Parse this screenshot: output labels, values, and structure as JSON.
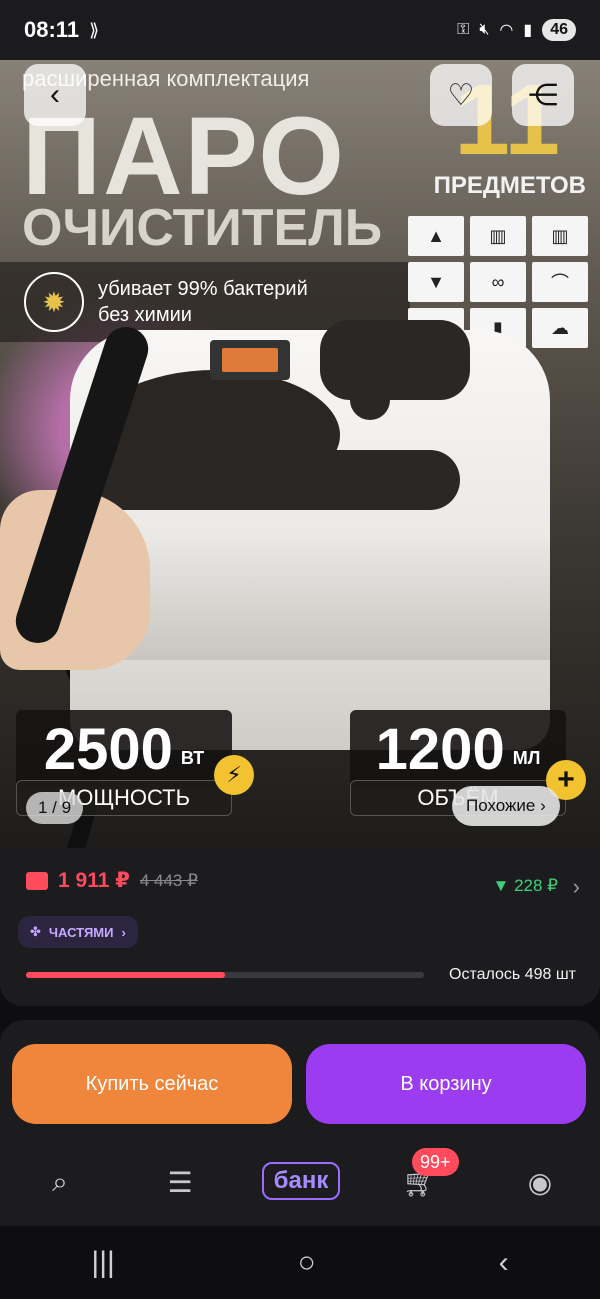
{
  "status_bar": {
    "time": "08:11",
    "battery": "46"
  },
  "product_image": {
    "top_text": "расширенная комплектация",
    "title_line1": "ПАРО",
    "title_line2": "ОЧИСТИТЕЛЬ",
    "items_count": "11",
    "items_label": "ПРЕДМЕТОВ",
    "badge_text_line1": "убивает 99% бактерий",
    "badge_text_line2": "без химии",
    "power_value": "2500",
    "power_unit": "ВТ",
    "power_label": "МОЩНОСТЬ",
    "volume_value": "1200",
    "volume_unit": "МЛ",
    "volume_label": "ОБЪЁМ",
    "pager": "1 / 9",
    "similar_label": "Похожие ›",
    "icons": {
      "back": "chevron-left-icon",
      "favorite": "heart-icon",
      "share": "share-icon"
    }
  },
  "price": {
    "current": "1 911 ₽",
    "old": "4 443 ₽",
    "cashback": "▼ 228 ₽",
    "installments_label": "ЧАСТЯМИ",
    "stock_label": "Осталось 498 шт",
    "stock_progress": 0.5
  },
  "actions": {
    "buy_now": "Купить сейчас",
    "add_to_cart": "В корзину"
  },
  "tabbar": {
    "bank_label": "банк",
    "cart_badge": "99+"
  },
  "colors": {
    "accent_red": "#ff4b5c",
    "buy_orange": "#f0853c",
    "cart_purple": "#9b3cf0",
    "cashback_green": "#3ecf7a"
  }
}
